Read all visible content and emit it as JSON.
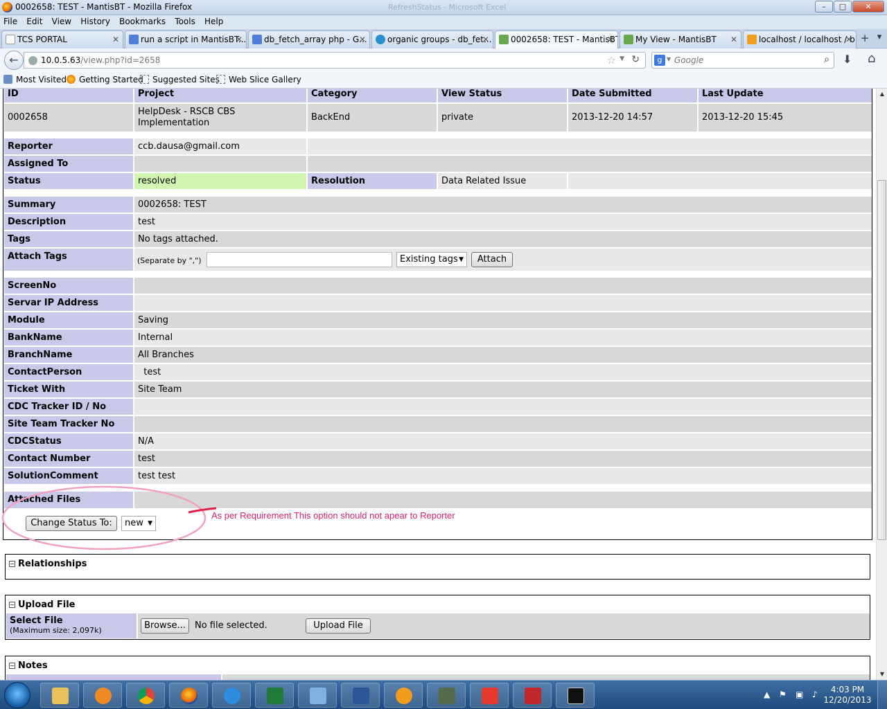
{
  "window": {
    "title": "0002658: TEST - MantisBT - Mozilla Firefox",
    "ghost_title": "RefreshStatus - Microsoft Excel"
  },
  "menu": [
    "File",
    "Edit",
    "View",
    "History",
    "Bookmarks",
    "Tools",
    "Help"
  ],
  "tabs": [
    {
      "label": "TCS PORTAL",
      "icon": "page-icon"
    },
    {
      "label": "run a script in MantisBT...",
      "icon": "google-icon"
    },
    {
      "label": "db_fetch_array php - G...",
      "icon": "google-icon"
    },
    {
      "label": "organic groups - db_fet...",
      "icon": "drupal-icon"
    },
    {
      "label": "0002658: TEST - MantisBT",
      "icon": "mantis-icon",
      "active": true
    },
    {
      "label": "My View - MantisBT",
      "icon": "mantis-icon"
    },
    {
      "label": "localhost / localhost / b...",
      "icon": "phpmyadmin-icon"
    }
  ],
  "url": {
    "host": "10.0.5.63",
    "path": "/view.php?id=2658"
  },
  "search": {
    "placeholder": "Google"
  },
  "bookmarks": [
    "Most Visited",
    "Getting Started",
    "Suggested Sites",
    "Web Slice Gallery"
  ],
  "issue": {
    "headers": [
      "ID",
      "Project",
      "Category",
      "View Status",
      "Date Submitted",
      "Last Update"
    ],
    "id": "0002658",
    "project": "HelpDesk - RSCB CBS Implementation",
    "category": "BackEnd",
    "view_status": "private",
    "date_submitted": "2013-12-20 14:57",
    "last_update": "2013-12-20 15:45",
    "labels": {
      "reporter": "Reporter",
      "assigned": "Assigned To",
      "status": "Status",
      "resolution": "Resolution",
      "summary": "Summary",
      "description": "Description",
      "tags": "Tags",
      "attach_tags": "Attach Tags"
    },
    "reporter": "ccb.dausa@gmail.com",
    "assigned_to": "",
    "status": "resolved",
    "resolution": "Data Related Issue",
    "summary": "0002658: TEST",
    "description": "test",
    "tags": "No tags attached.",
    "tag_hint": "(Separate by \",\")",
    "existing_tags": "Existing tags",
    "attach_button": "Attach"
  },
  "custom_fields": [
    {
      "label": "ScreenNo",
      "value": ""
    },
    {
      "label": "Servar IP Address",
      "value": ""
    },
    {
      "label": "Module",
      "value": "Saving"
    },
    {
      "label": "BankName",
      "value": "Internal"
    },
    {
      "label": "BranchName",
      "value": "All Branches"
    },
    {
      "label": "ContactPerson",
      "value": "  test"
    },
    {
      "label": "Ticket With",
      "value": "Site Team"
    },
    {
      "label": "CDC Tracker ID / No",
      "value": ""
    },
    {
      "label": "Site Team Tracker No",
      "value": ""
    },
    {
      "label": "CDCStatus",
      "value": "N/A"
    },
    {
      "label": "Contact Number",
      "value": "test"
    },
    {
      "label": "SolutionComment",
      "value": "test test"
    }
  ],
  "attached_files_label": "Attached Files",
  "change_status": {
    "button": "Change Status To:",
    "selected": "new"
  },
  "annotation": {
    "text": "As per Requirement This option should not apear to Reporter",
    "color": "#e0245e"
  },
  "sections": {
    "relationships": "Relationships",
    "upload": "Upload File",
    "notes": "Notes"
  },
  "upload": {
    "label": "Select File",
    "max_size": "(Maximum size: 2,097k)",
    "browse": "Browse...",
    "no_file": "No file selected.",
    "upload_button": "Upload File"
  },
  "colors": {
    "label_bg": "#c8c8e8",
    "value_bg": "#d8d8d8",
    "status_resolved": "#d2f5b0"
  },
  "clock": {
    "time": "4:03 PM",
    "date": "12/20/2013"
  }
}
